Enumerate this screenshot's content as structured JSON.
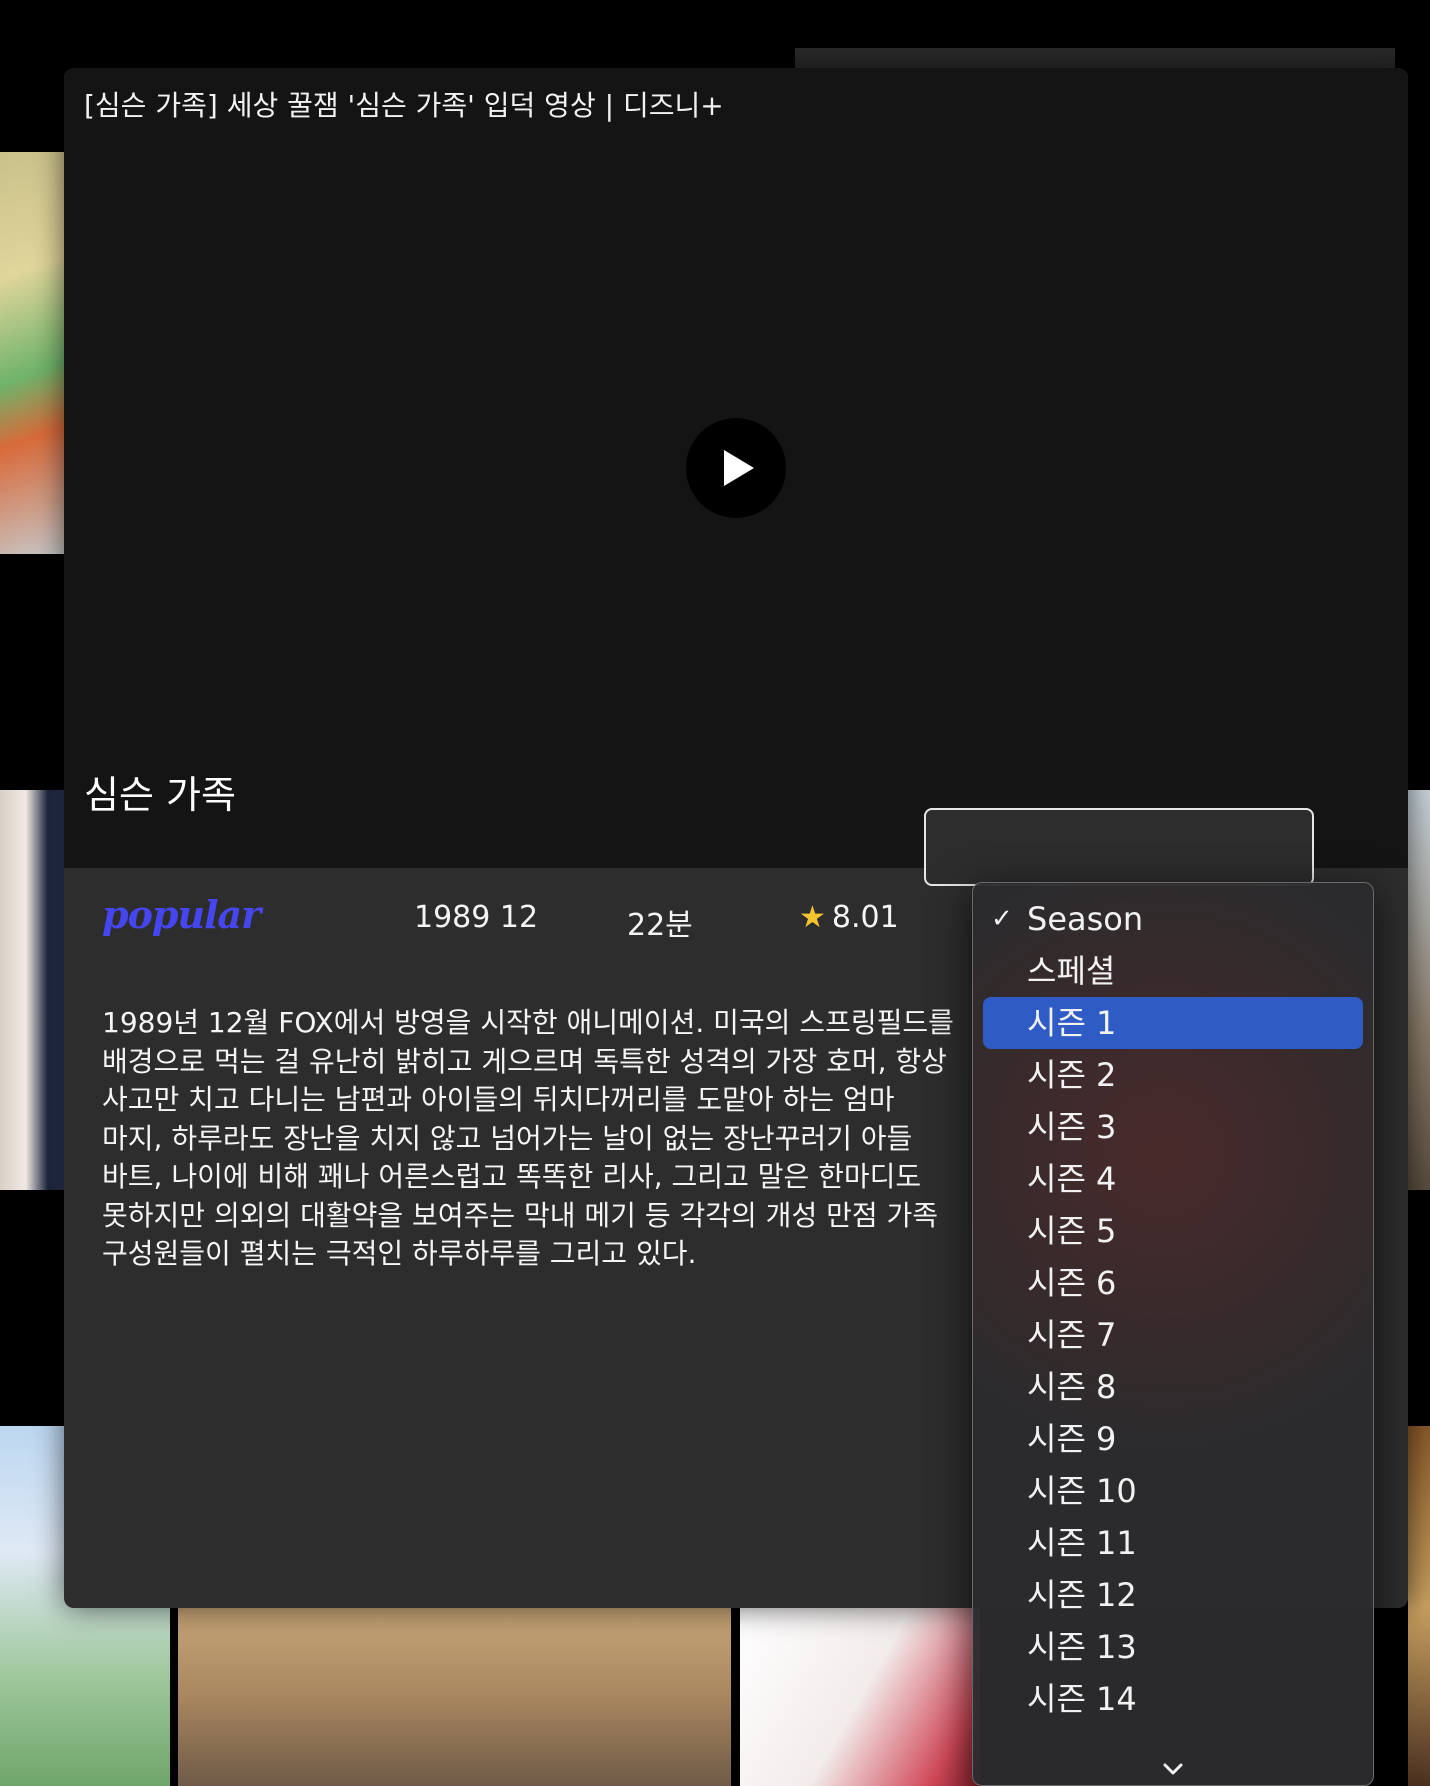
{
  "video": {
    "title": "[심슨 가족] 세상 꿀잼 '심슨 가족' 입덕 영상 | 디즈니+",
    "show_title": "심슨 가족"
  },
  "meta": {
    "badge": "popular",
    "date": "1989 12",
    "runtime": "22분",
    "rating": "8.01"
  },
  "overview": "1989년 12월 FOX에서 방영을 시작한 애니메이션. 미국의 스프링필드를 배경으로 먹는 걸 유난히 밝히고 게으르며 독특한 성격의 가장 호머, 항상 사고만 치고 다니는 남편과 아이들의 뒤치다꺼리를 도맡아 하는 엄마 마지, 하루라도 장난을 치지 않고 넘어가는 날이 없는 장난꾸러기 아들 바트, 나이에 비해 꽤나 어른스럽고 똑똑한 리사, 그리고 말은 한마디도 못하지만 의외의 대활약을 보여주는 막내 메기 등 각각의 개성 만점 가족 구성원들이 펼치는 극적인 하루하루를 그리고 있다.",
  "season_select": {
    "options": [
      "Season",
      "스페셜",
      "시즌 1",
      "시즌 2",
      "시즌 3",
      "시즌 4",
      "시즌 5",
      "시즌 6",
      "시즌 7",
      "시즌 8",
      "시즌 9",
      "시즌 10",
      "시즌 11",
      "시즌 12",
      "시즌 13",
      "시즌 14"
    ]
  },
  "colors": {
    "accent": "#4646f0",
    "highlight": "#2f5bc4",
    "star": "#f4c531"
  }
}
